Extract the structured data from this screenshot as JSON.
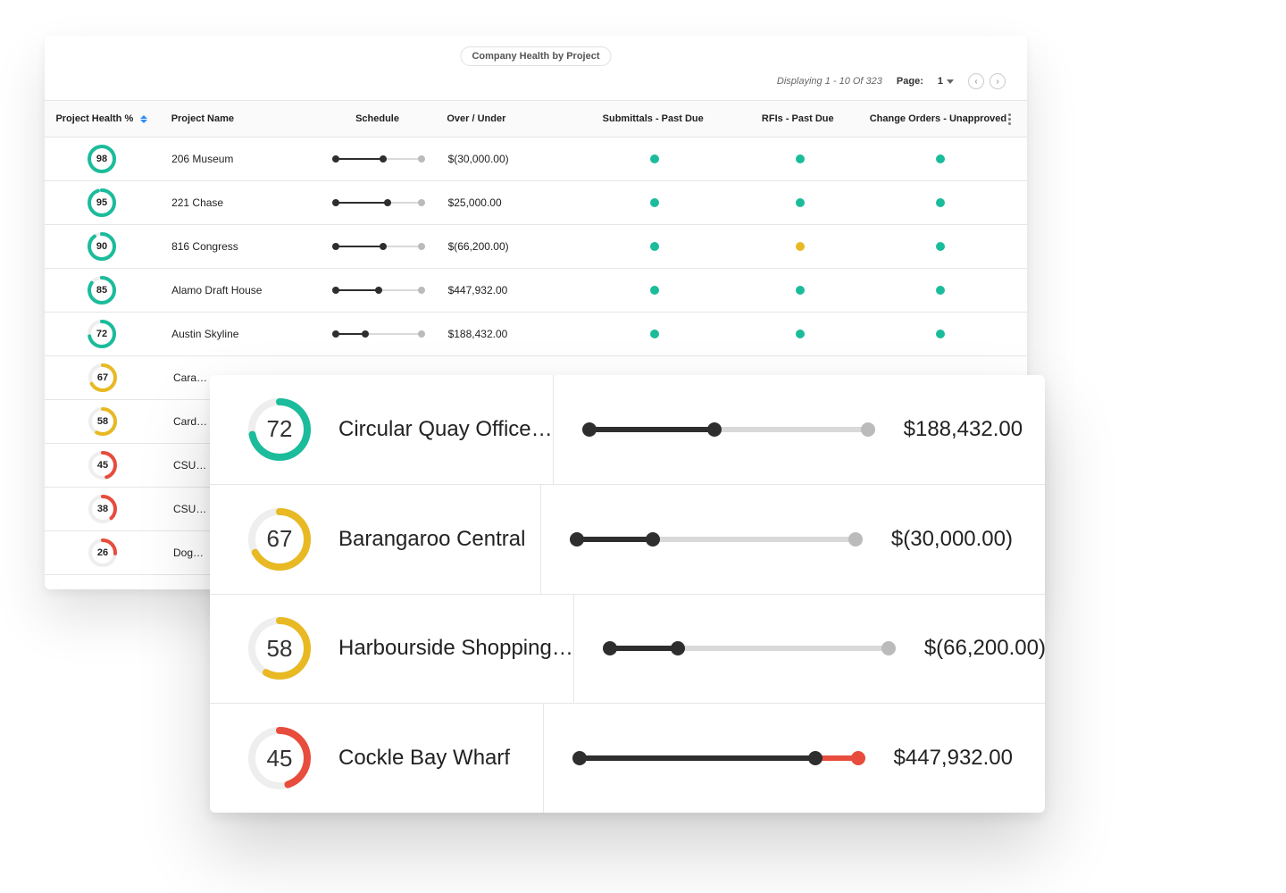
{
  "colors": {
    "teal": "#1bbc9b",
    "yellow": "#e8b923",
    "red": "#e74c3c"
  },
  "header": {
    "title": "Company Health by Project",
    "displaying": "Displaying 1 - 10 Of 323",
    "page_label": "Page:",
    "page_num": "1"
  },
  "columns": {
    "health": "Project Health %",
    "name": "Project Name",
    "schedule": "Schedule",
    "over_under": "Over / Under",
    "submittals": "Submittals - Past Due",
    "rfis": "RFIs - Past Due",
    "change_orders": "Change Orders - Unapproved"
  },
  "rows": [
    {
      "health": 98,
      "hcolor": "teal",
      "name": "206 Museum",
      "fill": 0.55,
      "over_under": "$(30,000.00)",
      "sub": "teal",
      "rfi": "teal",
      "co": "teal"
    },
    {
      "health": 95,
      "hcolor": "teal",
      "name": "221 Chase",
      "fill": 0.6,
      "over_under": "$25,000.00",
      "sub": "teal",
      "rfi": "teal",
      "co": "teal"
    },
    {
      "health": 90,
      "hcolor": "teal",
      "name": "816 Congress",
      "fill": 0.55,
      "over_under": "$(66,200.00)",
      "sub": "teal",
      "rfi": "yellow",
      "co": "teal"
    },
    {
      "health": 85,
      "hcolor": "teal",
      "name": "Alamo Draft House",
      "fill": 0.5,
      "over_under": "$447,932.00",
      "sub": "teal",
      "rfi": "teal",
      "co": "teal"
    },
    {
      "health": 72,
      "hcolor": "teal",
      "name": "Austin Skyline",
      "fill": 0.35,
      "over_under": "$188,432.00",
      "sub": "teal",
      "rfi": "teal",
      "co": "teal"
    },
    {
      "health": 67,
      "hcolor": "yellow",
      "name": "Cara…",
      "fill": 0,
      "over_under": "",
      "sub": "",
      "rfi": "",
      "co": ""
    },
    {
      "health": 58,
      "hcolor": "yellow",
      "name": "Card…",
      "fill": 0,
      "over_under": "",
      "sub": "",
      "rfi": "",
      "co": ""
    },
    {
      "health": 45,
      "hcolor": "red",
      "name": "CSU…",
      "fill": 0,
      "over_under": "",
      "sub": "",
      "rfi": "",
      "co": ""
    },
    {
      "health": 38,
      "hcolor": "red",
      "name": "CSU…",
      "fill": 0,
      "over_under": "",
      "sub": "",
      "rfi": "",
      "co": ""
    },
    {
      "health": 26,
      "hcolor": "red",
      "name": "Dog…",
      "fill": 0,
      "over_under": "",
      "sub": "",
      "rfi": "",
      "co": ""
    }
  ],
  "detail_rows": [
    {
      "health": 72,
      "hcolor": "teal",
      "name": "Circular Quay Office…",
      "fill": 0.45,
      "overrun": 0,
      "amount": "$188,432.00",
      "endcolor": "#bbb"
    },
    {
      "health": 67,
      "hcolor": "yellow",
      "name": "Barangaroo Central",
      "fill": 0.28,
      "overrun": 0,
      "amount": "$(30,000.00)",
      "endcolor": "#bbb"
    },
    {
      "health": 58,
      "hcolor": "yellow",
      "name": "Harbourside Shopping…",
      "fill": 0.25,
      "overrun": 0,
      "amount": "$(66,200.00)",
      "endcolor": "#bbb"
    },
    {
      "health": 45,
      "hcolor": "red",
      "name": "Cockle Bay Wharf",
      "fill": 0.84,
      "overrun": 0.16,
      "amount": "$447,932.00",
      "endcolor": "#e74c3c"
    }
  ]
}
